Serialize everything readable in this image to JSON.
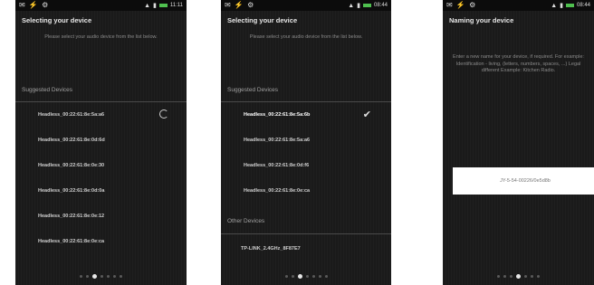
{
  "screens": [
    {
      "status_time": "11:11",
      "title": "Selecting your device",
      "info": "Please select your audio device from the list below.",
      "suggested_header": "Suggested Devices",
      "devices": [
        {
          "label": "Headless_00:22:61:8e:5a:a6",
          "state": "spinner"
        },
        {
          "label": "Headless_00:22:61:8e:0d:6d",
          "state": ""
        },
        {
          "label": "Headless_00:22:61:8e:0e:30",
          "state": ""
        },
        {
          "label": "Headless_00:22:61:8e:0d:0a",
          "state": ""
        },
        {
          "label": "Headless_00:22:61:8e:0e:12",
          "state": ""
        },
        {
          "label": "Headless_00:22:61:8e:0e:ca",
          "state": ""
        }
      ],
      "page_index": 2,
      "page_count": 7
    },
    {
      "status_time": "08:44",
      "title": "Selecting your device",
      "info": "Please select your audio device from the list below.",
      "suggested_header": "Suggested Devices",
      "devices": [
        {
          "label": "Headless_00:22:61:8e:5a:6b",
          "state": "selected"
        },
        {
          "label": "Headless_00:22:61:8e:5a:a6",
          "state": ""
        },
        {
          "label": "Headless_00:22:61:8e:0d:f6",
          "state": ""
        },
        {
          "label": "Headless_00:22:61:8e:0e:ca",
          "state": ""
        }
      ],
      "other_header": "Other Devices",
      "other_devices": [
        {
          "label": "TP-LINK_2.4GHz_8F87E7"
        }
      ],
      "page_index": 2,
      "page_count": 7
    },
    {
      "status_time": "08:44",
      "title": "Naming your device",
      "info": "Enter a new name for your device, if required. For example: Identification - living, (letters, numbers, spaces, ...) Legal different Example: Kitchen Radio.",
      "input_value": "JY-5-54-00226/0e5d8b",
      "page_index": 3,
      "page_count": 7
    }
  ]
}
